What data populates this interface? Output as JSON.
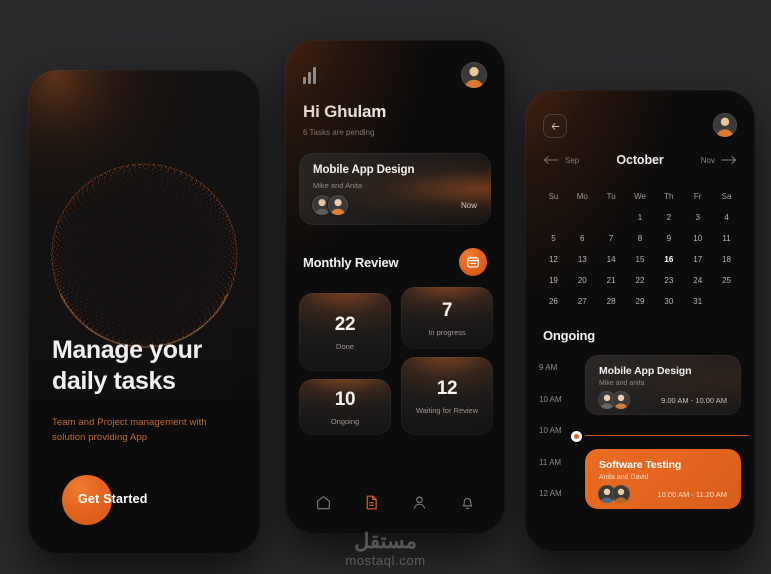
{
  "meta": {
    "watermark_arabic": "مستقل",
    "watermark_latin": "mostaql.com"
  },
  "colors": {
    "accent": "#e3641e",
    "accent_light": "#f07c33",
    "background": "#2b2b2e",
    "screen": "#121010",
    "text": "#f3f1ef",
    "muted": "#8d8885"
  },
  "phone1": {
    "title_line1": "Manage your",
    "title_line2": "daily tasks",
    "subtitle_line1": "Team and Project management with",
    "subtitle_line2": "solution providing App",
    "cta_label": "Get Started",
    "art_icon": "particle-sphere-illustration"
  },
  "phone2": {
    "signal_icon": "signal-bars-icon",
    "avatar_icon": "user-avatar",
    "greeting": "Hi Ghulam",
    "pending": "6 Tasks are pending",
    "task_card": {
      "title": "Mobile App Design",
      "members": "Mike and Anita",
      "time_label": "Now",
      "avatars": [
        "avatar-mike",
        "avatar-anita"
      ]
    },
    "review_title": "Monthly Review",
    "review_icon": "calendar-icon",
    "stats": [
      {
        "value": "22",
        "label": "Done"
      },
      {
        "value": "7",
        "label": "In progress"
      },
      {
        "value": "10",
        "label": "Ongoing"
      },
      {
        "value": "12",
        "label": "Waiting for Review"
      }
    ],
    "nav": [
      {
        "icon": "home-icon",
        "active": false
      },
      {
        "icon": "document-icon",
        "active": true
      },
      {
        "icon": "person-icon",
        "active": false
      },
      {
        "icon": "bell-icon",
        "active": false
      }
    ]
  },
  "phone3": {
    "back_icon": "arrow-left-icon",
    "avatar_icon": "user-avatar",
    "calendar": {
      "prev_month": "Sep",
      "month": "October",
      "next_month": "Nov",
      "prev_icon": "arrow-left-icon",
      "next_icon": "arrow-right-icon",
      "weekdays": [
        "Su",
        "Mo",
        "Tu",
        "We",
        "Th",
        "Fr",
        "Sa"
      ],
      "lead_blanks": 3,
      "days": [
        1,
        2,
        3,
        4,
        5,
        6,
        7,
        8,
        9,
        10,
        11,
        12,
        13,
        14,
        15,
        16,
        17,
        18,
        19,
        20,
        21,
        22,
        23,
        24,
        25,
        26,
        27,
        28,
        29,
        30,
        31
      ],
      "selected_day": 16
    },
    "ongoing_title": "Ongoing",
    "time_labels": [
      "9 AM",
      "10 AM",
      "10 AM",
      "11 AM",
      "12 AM"
    ],
    "events": [
      {
        "title": "Mobile App Design",
        "members": "Mike and anita",
        "time": "9.00 AM - 10.00 AM",
        "highlight": false,
        "avatars": [
          "avatar-mike",
          "avatar-anita"
        ]
      },
      {
        "title": "Software Testing",
        "members": "Anita and David",
        "time": "10.00 AM - 11.20 AM",
        "highlight": true,
        "avatars": [
          "avatar-anita",
          "avatar-david"
        ]
      }
    ],
    "now_marker_icon": "current-time-dot"
  }
}
